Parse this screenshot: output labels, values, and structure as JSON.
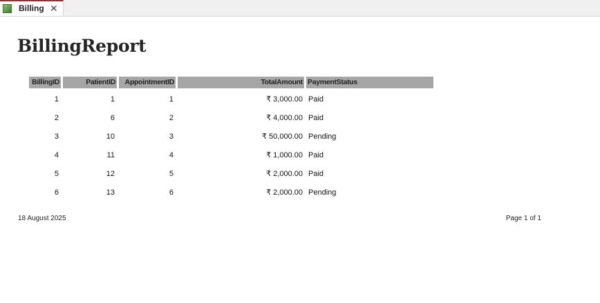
{
  "tab": {
    "label": "Billing",
    "icon": "report-icon",
    "close": "✕"
  },
  "report": {
    "title": "BillingReport",
    "columns": [
      "BillingID",
      "PatientID",
      "AppointmentID",
      "TotalAmount",
      "PaymentStatus"
    ],
    "rows": [
      [
        "1",
        "1",
        "1",
        "₹ 3,000.00",
        "Paid"
      ],
      [
        "2",
        "6",
        "2",
        "₹ 4,000.00",
        "Paid"
      ],
      [
        "3",
        "10",
        "3",
        "₹ 50,000.00",
        "Pending"
      ],
      [
        "4",
        "11",
        "4",
        "₹ 1,000.00",
        "Paid"
      ],
      [
        "5",
        "12",
        "5",
        "₹ 2,000.00",
        "Paid"
      ],
      [
        "6",
        "13",
        "6",
        "₹ 2,000.00",
        "Pending"
      ]
    ]
  },
  "footer": {
    "date": "18 August 2025",
    "page": "Page 1 of 1"
  },
  "colors": {
    "header_fill": "#a6a6a6",
    "tab_accent": "#a4262c"
  }
}
